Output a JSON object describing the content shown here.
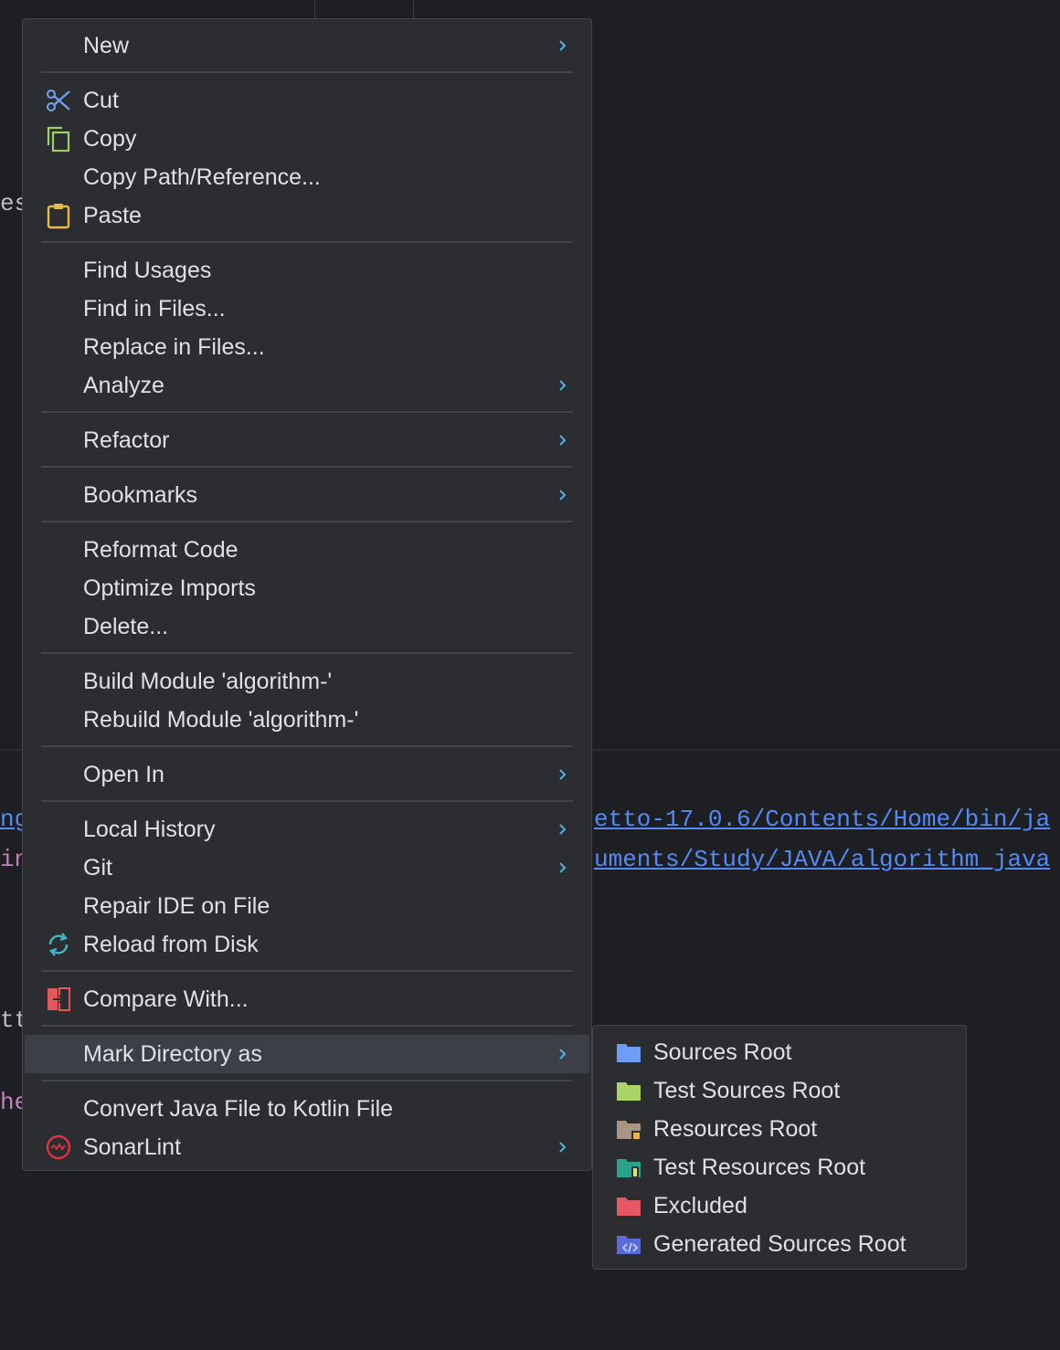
{
  "background": {
    "left_fragments": [
      "es",
      "ng",
      "in",
      "tt",
      "he"
    ],
    "console_paths": [
      "etto-17.0.6/Contents/Home/bin/ja",
      "uments/Study/JAVA/algorithm_java"
    ]
  },
  "menu": {
    "items": [
      {
        "label": "New",
        "submenu": true
      },
      {
        "label": "Cut",
        "icon": "scissors-icon"
      },
      {
        "label": "Copy",
        "icon": "copy-icon"
      },
      {
        "label": "Copy Path/Reference..."
      },
      {
        "label": "Paste",
        "icon": "clipboard-icon"
      },
      {
        "label": "Find Usages"
      },
      {
        "label": "Find in Files..."
      },
      {
        "label": "Replace in Files..."
      },
      {
        "label": "Analyze",
        "submenu": true
      },
      {
        "label": "Refactor",
        "submenu": true
      },
      {
        "label": "Bookmarks",
        "submenu": true
      },
      {
        "label": "Reformat Code"
      },
      {
        "label": "Optimize Imports"
      },
      {
        "label": "Delete..."
      },
      {
        "label": "Build Module 'algorithm-'"
      },
      {
        "label": "Rebuild Module 'algorithm-'"
      },
      {
        "label": "Open In",
        "submenu": true
      },
      {
        "label": "Local History",
        "submenu": true
      },
      {
        "label": "Git",
        "submenu": true
      },
      {
        "label": "Repair IDE on File"
      },
      {
        "label": "Reload from Disk",
        "icon": "reload-icon"
      },
      {
        "label": "Compare With...",
        "icon": "compare-icon"
      },
      {
        "label": "Mark Directory as",
        "submenu": true,
        "highlighted": true
      },
      {
        "label": "Convert Java File to Kotlin File"
      },
      {
        "label": "SonarLint",
        "icon": "sonarlint-icon",
        "submenu": true
      }
    ]
  },
  "submenu": {
    "items": [
      {
        "label": "Sources Root",
        "icon": "sources-root-folder-icon",
        "color": "#6f9cf7"
      },
      {
        "label": "Test Sources Root",
        "icon": "test-sources-root-folder-icon",
        "color": "#a8d468"
      },
      {
        "label": "Resources Root",
        "icon": "resources-root-folder-icon",
        "color": "#a89584"
      },
      {
        "label": "Test Resources Root",
        "icon": "test-resources-root-folder-icon",
        "color": "#2aa38c"
      },
      {
        "label": "Excluded",
        "icon": "excluded-folder-icon",
        "color": "#e55765"
      },
      {
        "label": "Generated Sources Root",
        "icon": "generated-sources-root-folder-icon",
        "color": "#5c6bd8"
      }
    ]
  },
  "colors": {
    "accent_arrow": "#4fb3e6",
    "menu_bg": "#2b2d30",
    "highlight": "#3c3f45"
  }
}
